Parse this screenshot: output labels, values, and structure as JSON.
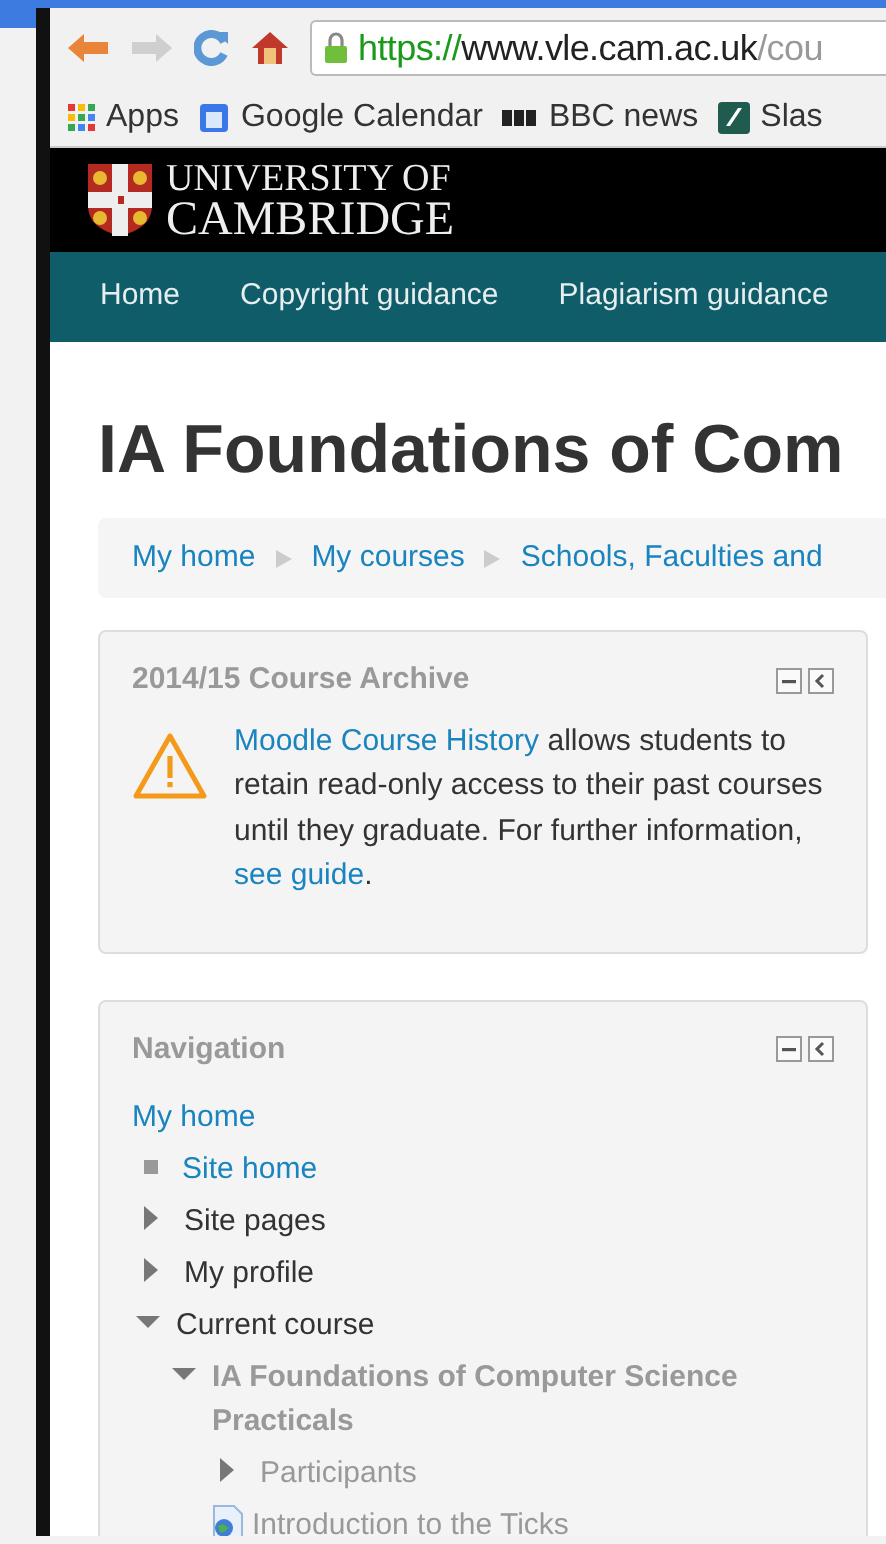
{
  "browser": {
    "url_secure": "https://",
    "url_host": "www.vle.cam.ac.uk",
    "url_path": "/cou",
    "bookmarks": [
      {
        "label": "Apps",
        "kind": "apps"
      },
      {
        "label": "Google Calendar",
        "kind": "calendar"
      },
      {
        "label": "BBC news",
        "kind": "bbc"
      },
      {
        "label": "Slas",
        "kind": "slash"
      }
    ]
  },
  "header": {
    "logo_line1": "UNIVERSITY OF",
    "logo_line2": "CAMBRIDGE"
  },
  "menu": [
    {
      "label": "Home"
    },
    {
      "label": "Copyright guidance"
    },
    {
      "label": "Plagiarism guidance"
    }
  ],
  "page_title": "IA Foundations of Com",
  "breadcrumb": [
    {
      "label": "My home"
    },
    {
      "label": "My courses"
    },
    {
      "label": "Schools, Faculties and"
    }
  ],
  "archive_block": {
    "title": "2014/15 Course Archive",
    "message": [
      {
        "text": "Moodle Course History",
        "link": true
      },
      {
        "text": " allows students to retain read-only access to their past courses until they graduate. For further information, ",
        "link": false
      },
      {
        "text": "see guide",
        "link": true
      },
      {
        "text": ".",
        "link": false
      }
    ]
  },
  "navigation_block": {
    "title": "Navigation",
    "root": "My home",
    "items": [
      {
        "label": "Site home",
        "kind": "leaf",
        "link": true
      },
      {
        "label": "Site pages",
        "kind": "branch",
        "expanded": false
      },
      {
        "label": "My profile",
        "kind": "branch",
        "expanded": false
      },
      {
        "label": "Current course",
        "kind": "branch",
        "expanded": true,
        "children": [
          {
            "label": "IA Foundations of Computer Science Practicals",
            "kind": "course",
            "expanded": true,
            "children": [
              {
                "label": "Participants",
                "kind": "branch",
                "expanded": false,
                "muted": true
              },
              {
                "label": "Introduction to the Ticks",
                "kind": "page",
                "muted": true
              }
            ]
          }
        ]
      }
    ]
  }
}
